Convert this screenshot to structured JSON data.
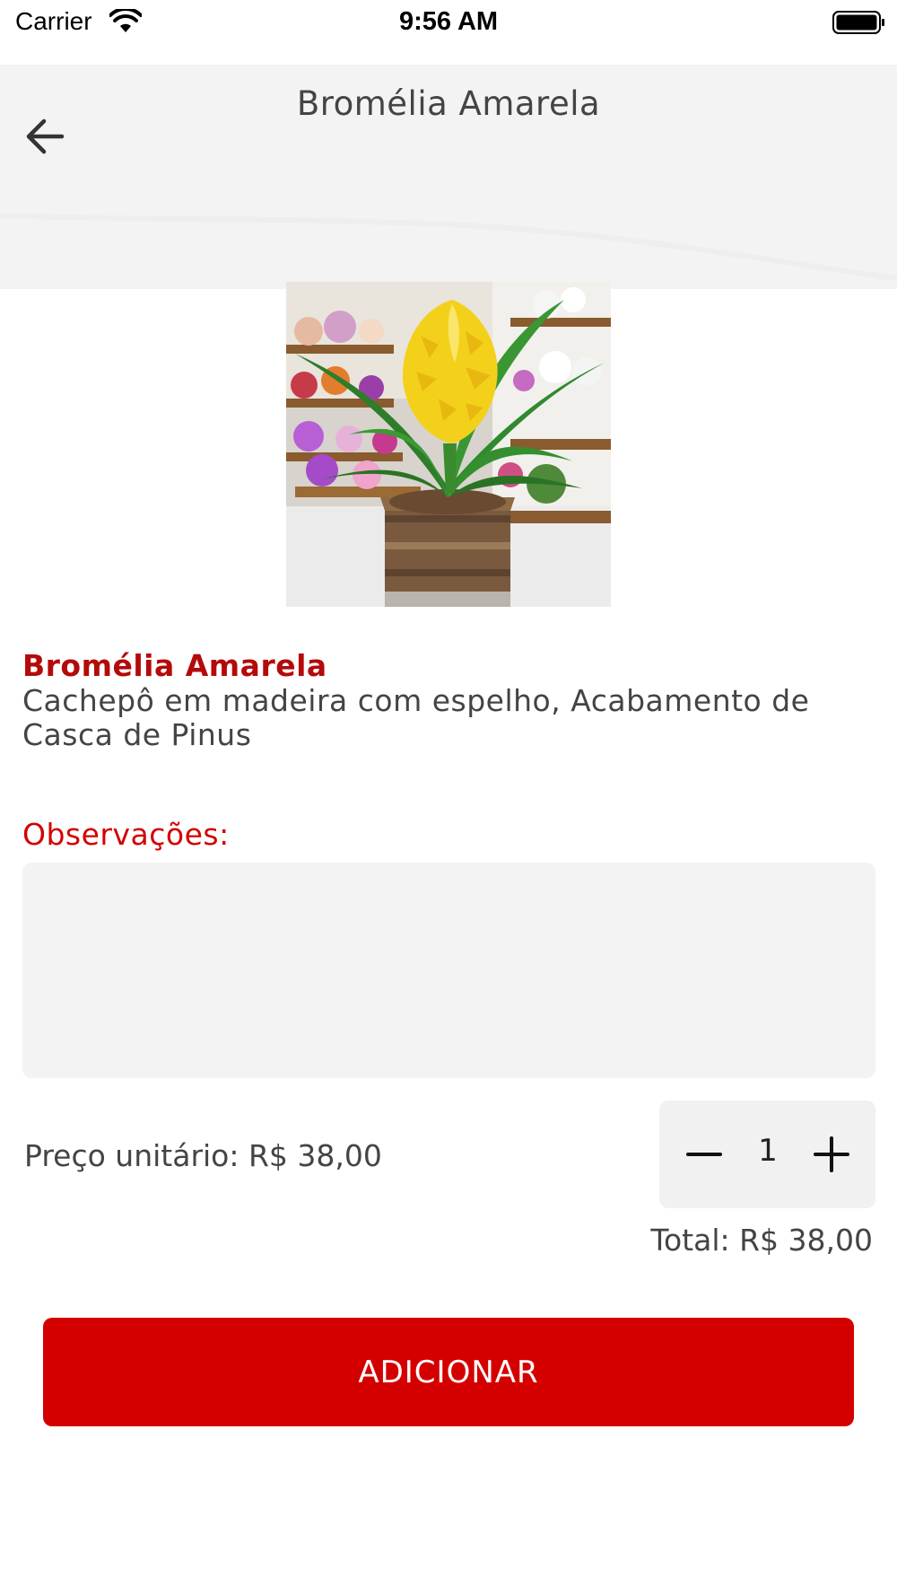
{
  "status_bar": {
    "carrier": "Carrier",
    "time": "9:56 AM",
    "wifi_icon": "wifi-icon",
    "battery_icon": "battery-icon"
  },
  "header": {
    "title": "Bromélia Amarela",
    "back_icon": "arrow-left-icon",
    "background_color": "#f3f3f3"
  },
  "product": {
    "image_alt": "Bromélia Amarela",
    "name": "Bromélia Amarela",
    "description": "Cachepô em madeira com espelho, Acabamento de Casca de Pinus"
  },
  "observations": {
    "label": "Observações:",
    "value": "",
    "placeholder": ""
  },
  "pricing": {
    "unit_price_label": "Preço unitário: R$ 38,00",
    "quantity": "1",
    "total_label": "Total: R$ 38,00"
  },
  "stepper": {
    "minus_icon": "minus-icon",
    "plus_icon": "plus-icon"
  },
  "actions": {
    "add_label": "ADICIONAR"
  },
  "colors": {
    "accent": "#d40000",
    "product_name": "#b40a0a",
    "text": "#444444",
    "field_bg": "#f3f3f3"
  }
}
